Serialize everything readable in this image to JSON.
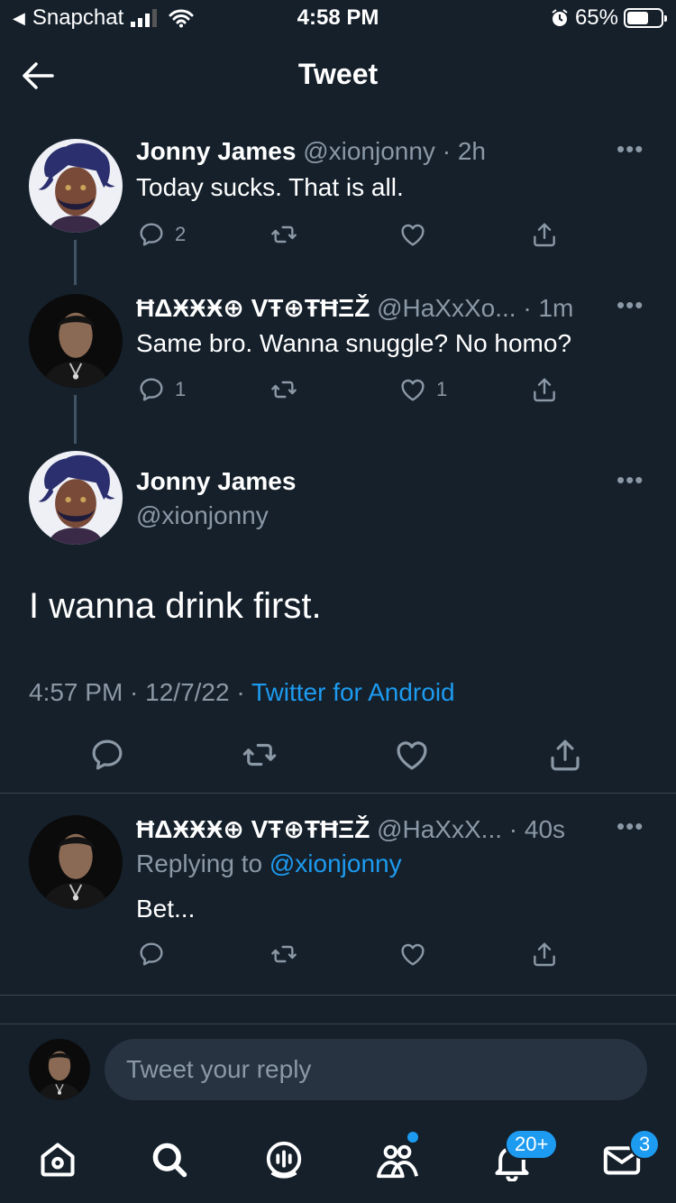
{
  "status_bar": {
    "back_app": "Snapchat",
    "time": "4:58 PM",
    "battery": "65%",
    "battery_level": 0.65
  },
  "header": {
    "title": "Tweet"
  },
  "tweets": [
    {
      "name": "Jonny James",
      "handle": "@xionjonny",
      "age": "· 2h",
      "text": "Today sucks. That is all.",
      "replies": "2",
      "retweets": "",
      "likes": ""
    },
    {
      "name": "ĦΔӾӾӾ⊕ VŦ⊕ŦĦΞŽ",
      "handle": "@HaXxXo... · 1m",
      "text": "Same bro. Wanna snuggle? No homo?",
      "replies": "1",
      "retweets": "",
      "likes": "1"
    }
  ],
  "main_tweet": {
    "name": "Jonny James",
    "handle": "@xionjonny",
    "text": "I wanna drink first.",
    "time": "4:57 PM · 12/7/22 ·",
    "source": "Twitter for Android"
  },
  "reply": {
    "name": "ĦΔӾӾӾ⊕ VŦ⊕ŦĦΞŽ",
    "handle": "@HaXxX... · 40s",
    "replying_prefix": "Replying to",
    "replying_to": "@xionjonny",
    "text": "Bet..."
  },
  "compose": {
    "placeholder": "Tweet your reply"
  },
  "bottom_nav": {
    "notifications_badge": "20+",
    "messages_badge": "3"
  },
  "colors": {
    "background": "#15202b",
    "accent": "#1d9bf0",
    "muted": "#8b98a5"
  },
  "icons": [
    "back-arrow-icon",
    "more-icon",
    "reply-icon",
    "retweet-icon",
    "like-icon",
    "share-icon",
    "home-icon",
    "search-icon",
    "spaces-icon",
    "communities-icon",
    "notifications-icon",
    "messages-icon"
  ]
}
